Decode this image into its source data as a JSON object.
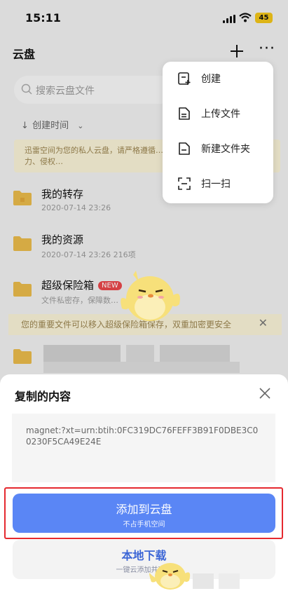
{
  "status_bar": {
    "time": "15:11",
    "battery": "45"
  },
  "header": {
    "title": "云盘",
    "more_glyph": "···"
  },
  "search": {
    "placeholder": "搜索云盘文件"
  },
  "sort": {
    "label": "创建时间"
  },
  "notice_top": {
    "text": "迅雷空间为您的私人云盘，请严格遵循…放、传输任何涉密、色情、暴力、侵权…"
  },
  "files": [
    {
      "name": "我的转存",
      "meta": "2020-07-14 23:26"
    },
    {
      "name": "我的资源",
      "meta": "2020-07-14 23:26  216项"
    },
    {
      "name": "超级保险箱",
      "badge": "NEW",
      "meta": "文件私密存，保障数…"
    }
  ],
  "notice_vault": {
    "text": "您的重要文件可以移入超级保险箱保存，双重加密更安全",
    "close": "✕"
  },
  "popover_menu": [
    {
      "label": "创建",
      "icon": "create-doc-icon"
    },
    {
      "label": "上传文件",
      "icon": "upload-file-icon"
    },
    {
      "label": "新建文件夹",
      "icon": "new-folder-icon"
    },
    {
      "label": "扫一扫",
      "icon": "scan-icon"
    }
  ],
  "sheet": {
    "title": "复制的内容",
    "content": "magnet:?xt=urn:btih:0FC319DC76FEFF3B91F0DBE3C00230F5CA49E24E",
    "primary_label": "添加到云盘",
    "primary_sub": "不占手机空间",
    "secondary_label": "本地下载",
    "secondary_sub": "一键云添加并下载"
  },
  "colors": {
    "accent": "#5a86f5",
    "highlight_border": "#e5292f",
    "notice_bg": "#f7f0d5",
    "folder": "#e8b94a"
  }
}
